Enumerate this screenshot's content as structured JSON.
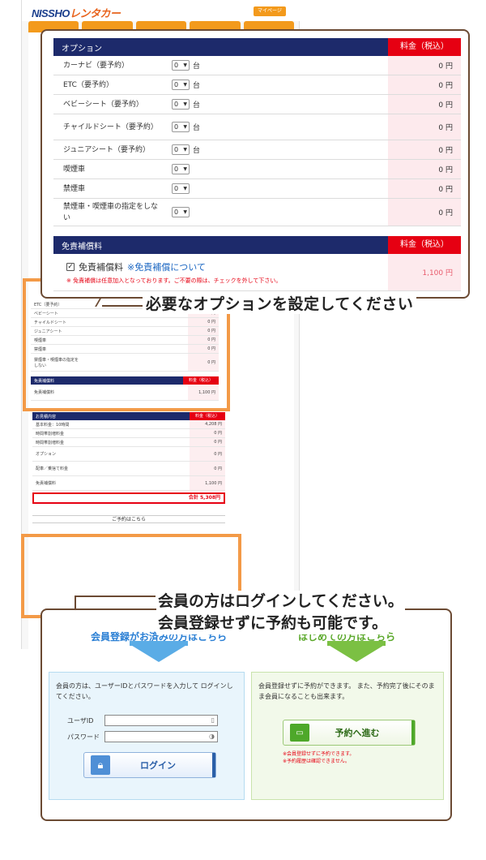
{
  "site": {
    "logo_text": "NISSHO",
    "logo_kana": "レンタカー",
    "mypage_label": "マイページ",
    "mini_header_option": "オプション",
    "mini_header_price": "料金（税込）",
    "mini_ins_header": "免責補償料",
    "mini_summary_header": "お見積内容",
    "mini_reserve_header": "ご予約はこちら",
    "mini_total": "合計 5,308円"
  },
  "options": {
    "header_label": "オプション",
    "price_header": "料金（税込）",
    "unit": "台",
    "items": [
      {
        "name": "カーナビ（要予約）",
        "qty": "0",
        "unit": "台",
        "price": "0 円"
      },
      {
        "name": "ETC（要予約）",
        "qty": "0",
        "unit": "台",
        "price": "0 円"
      },
      {
        "name": "ベビーシート（要予約）",
        "qty": "0",
        "unit": "台",
        "price": "0 円"
      },
      {
        "name": "チャイルドシート（要予約）",
        "qty": "0",
        "unit": "台",
        "price": "0 円"
      },
      {
        "name": "ジュニアシート（要予約）",
        "qty": "0",
        "unit": "台",
        "price": "0 円"
      },
      {
        "name": "喫煙車",
        "qty": "0",
        "unit": "",
        "price": "0 円"
      },
      {
        "name": "禁煙車",
        "qty": "0",
        "unit": "",
        "price": "0 円"
      },
      {
        "name": "禁煙車・喫煙車の指定をしない",
        "qty": "0",
        "unit": "",
        "price": "0 円"
      }
    ]
  },
  "insurance": {
    "header_label": "免責補償料",
    "price_header": "料金（税込）",
    "checkbox_label": "免責補償料",
    "link_label": "※免責補償について",
    "note": "※ 免責補償は任意加入となっております。ご不要の際は、チェックを外して下さい。",
    "price": "1,100 円"
  },
  "callouts": {
    "top": "必要なオプションを設定してください",
    "bottom_line1": "会員の方はログインしてください。",
    "bottom_line2": "会員登録せずに予約も可能です。"
  },
  "login": {
    "heading": "会員登録がお済みの方はこちら",
    "description": "会員の方は、ユーザーIDとパスワードを入力して ログインしてください。",
    "user_label": "ユーザID",
    "password_label": "パスワード",
    "button_label": "ログイン"
  },
  "first_time": {
    "heading": "はじめての方はこちら",
    "description": "会員登録せずに予約ができます。 また、予約完了後にそのまま会員になることも出来ます。",
    "button_label": "予約へ進む",
    "note1": "※会員登録せずに予約できます。",
    "note2": "※予約履歴は確認できません。"
  },
  "colors": {
    "header_navy": "#1d2a6b",
    "price_red": "#e60012",
    "callout_border": "#6b4a33",
    "highlight_orange": "#f39a47"
  }
}
